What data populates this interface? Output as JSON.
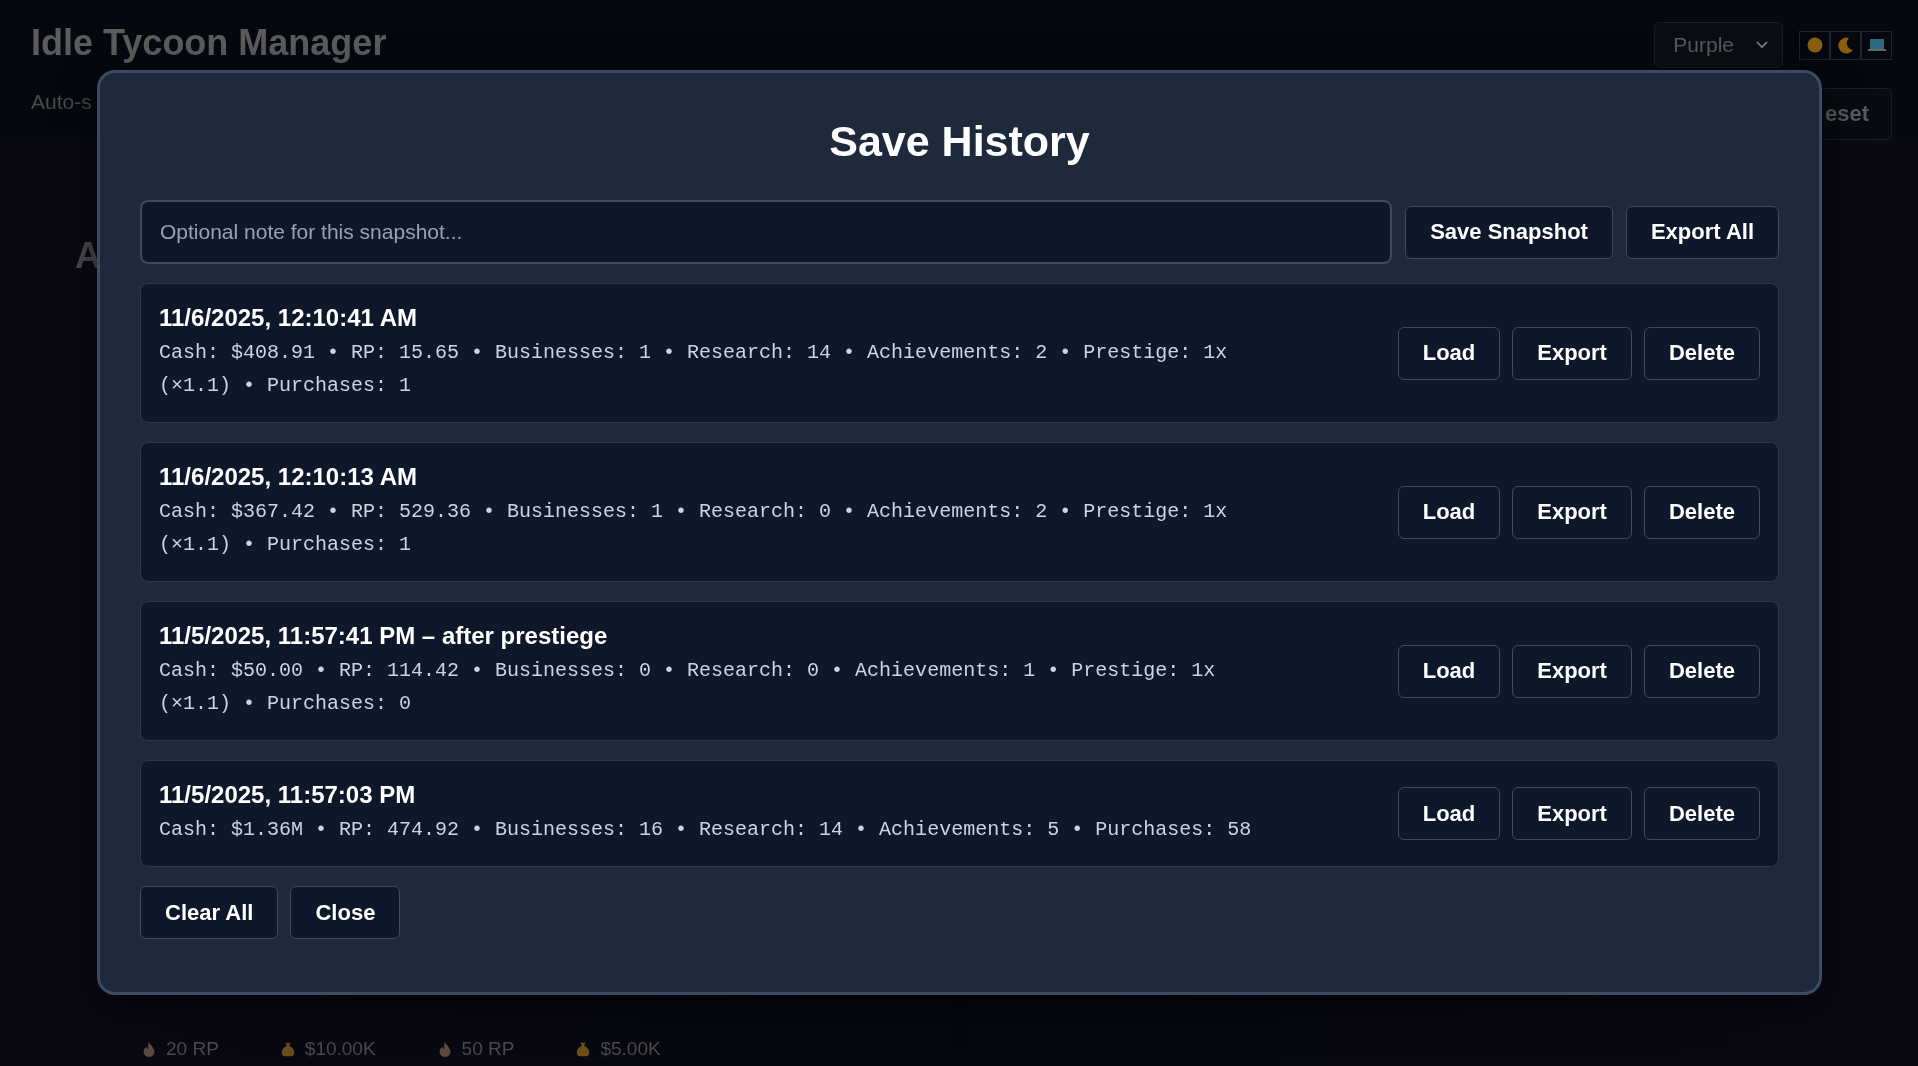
{
  "page": {
    "title": "Idle Tycoon Manager",
    "subtitle": "Auto-s",
    "theme_select": {
      "value": "Purple"
    },
    "theme_buttons": [
      {
        "kind": "sun"
      },
      {
        "kind": "moon"
      },
      {
        "kind": "laptop"
      }
    ],
    "reset_button": "eset",
    "section_heading": "A",
    "bottom_items": [
      {
        "kind": "rp",
        "text": "20 RP"
      },
      {
        "kind": "money",
        "text": "$10.00K"
      },
      {
        "kind": "rp",
        "text": "50 RP"
      },
      {
        "kind": "money",
        "text": "$5.00K"
      }
    ]
  },
  "modal": {
    "title": "Save History",
    "note_field": {
      "placeholder": "Optional note for this snapshot..."
    },
    "header_buttons": [
      "Save Snapshot",
      "Export All"
    ],
    "snapshots": [
      {
        "title": "11/6/2025, 12:10:41 AM",
        "details": "Cash: $408.91 • RP: 15.65 • Businesses: 1 • Research: 14 • Achievements: 2 • Prestige: 1x (×1.1) • Purchases: 1",
        "actions": [
          "Load",
          "Export",
          "Delete"
        ]
      },
      {
        "title": "11/6/2025, 12:10:13 AM",
        "details": "Cash: $367.42 • RP: 529.36 • Businesses: 1 • Research: 0 • Achievements: 2 • Prestige: 1x (×1.1) • Purchases: 1",
        "actions": [
          "Load",
          "Export",
          "Delete"
        ]
      },
      {
        "title": "11/5/2025, 11:57:41 PM – after prestiege",
        "details": "Cash: $50.00 • RP: 114.42 • Businesses: 0 • Research: 0 • Achievements: 1 • Prestige: 1x (×1.1) • Purchases: 0",
        "actions": [
          "Load",
          "Export",
          "Delete"
        ]
      },
      {
        "title": "11/5/2025, 11:57:03 PM",
        "details": "Cash: $1.36M • RP: 474.92 • Businesses: 16 • Research: 14 • Achievements: 5 • Purchases: 58",
        "actions": [
          "Load",
          "Export",
          "Delete"
        ]
      }
    ],
    "footer_buttons": [
      "Clear All",
      "Close"
    ]
  }
}
